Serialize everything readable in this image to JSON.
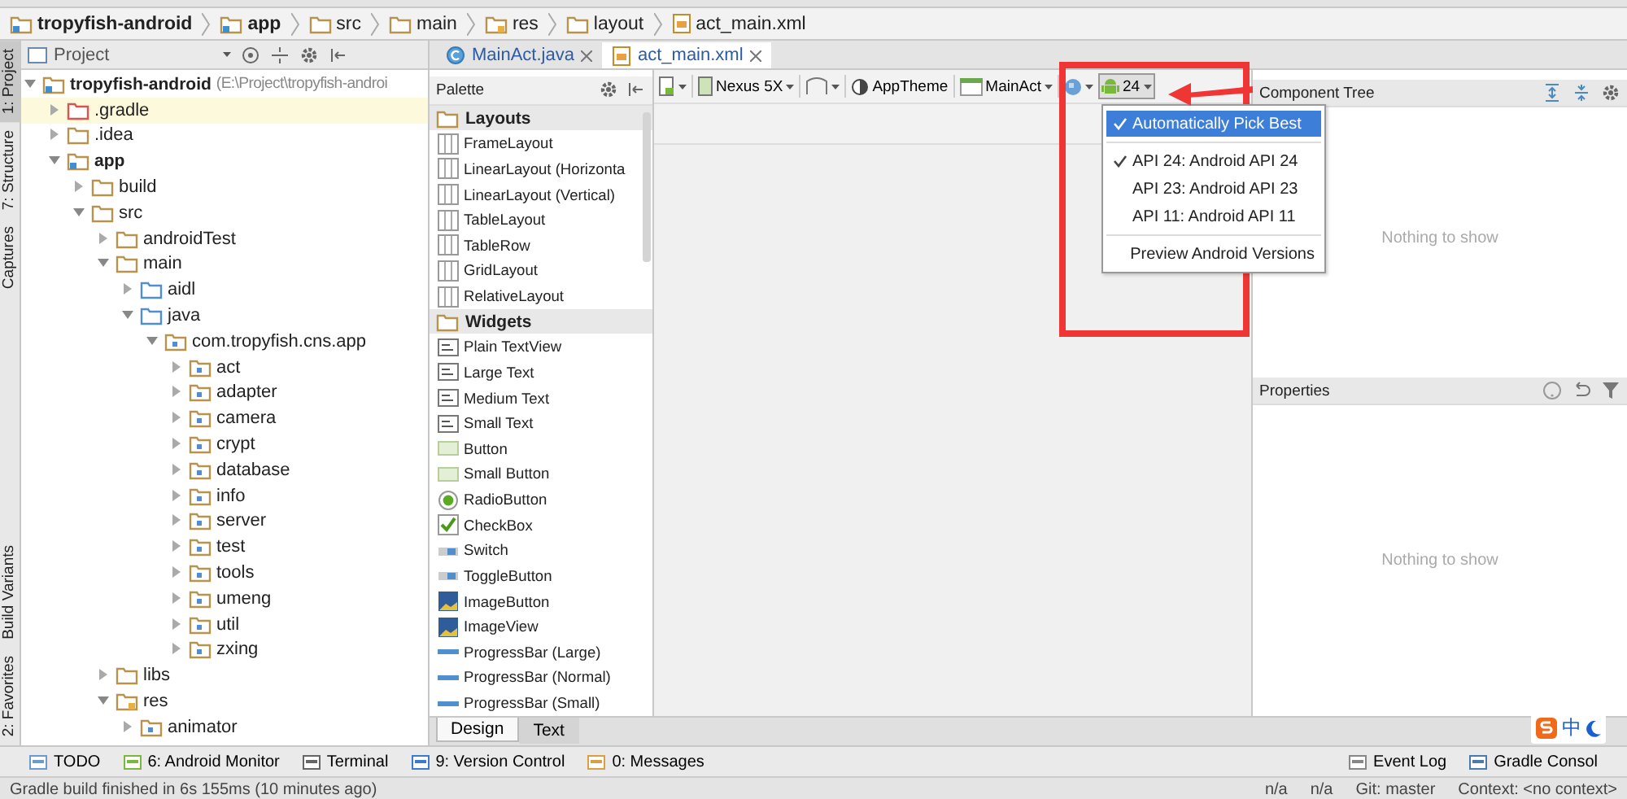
{
  "breadcrumbs": [
    {
      "label": "tropyfish-android",
      "kind": "module"
    },
    {
      "label": "app",
      "kind": "module"
    },
    {
      "label": "src",
      "kind": "folder"
    },
    {
      "label": "main",
      "kind": "folder"
    },
    {
      "label": "res",
      "kind": "resources"
    },
    {
      "label": "layout",
      "kind": "folder"
    },
    {
      "label": "act_main.xml",
      "kind": "xml"
    }
  ],
  "side_tabs_top": [
    {
      "label": "1: Project",
      "selected": true
    },
    {
      "label": "7: Structure",
      "selected": false
    },
    {
      "label": "Captures",
      "selected": false
    }
  ],
  "side_tabs_bottom": [
    {
      "label": "Build Variants",
      "selected": false
    },
    {
      "label": "2: Favorites",
      "selected": false
    }
  ],
  "project": {
    "view": "Project",
    "tree": [
      {
        "label": "tropyfish-android",
        "path": "(E:\\Project\\tropyfish-androi",
        "kind": "module",
        "expanded": true,
        "selected": false,
        "children": [
          {
            "label": ".gradle",
            "kind": "excluded",
            "expanded": false,
            "selected": true
          },
          {
            "label": ".idea",
            "kind": "folder",
            "expanded": false,
            "selected": false
          },
          {
            "label": "app",
            "kind": "module",
            "expanded": true,
            "selected": false,
            "children": [
              {
                "label": "build",
                "kind": "folder",
                "expanded": false,
                "selected": false
              },
              {
                "label": "src",
                "kind": "folder",
                "expanded": true,
                "selected": false,
                "children": [
                  {
                    "label": "androidTest",
                    "kind": "folder",
                    "expanded": false,
                    "selected": false
                  },
                  {
                    "label": "main",
                    "kind": "folder",
                    "expanded": true,
                    "selected": false,
                    "children": [
                      {
                        "label": "aidl",
                        "kind": "source",
                        "expanded": false,
                        "selected": false
                      },
                      {
                        "label": "java",
                        "kind": "source",
                        "expanded": true,
                        "selected": false,
                        "children": [
                          {
                            "label": "com.tropyfish.cns.app",
                            "kind": "package",
                            "expanded": true,
                            "selected": false,
                            "children": [
                              {
                                "label": "act",
                                "kind": "package",
                                "expanded": false,
                                "selected": false
                              },
                              {
                                "label": "adapter",
                                "kind": "package",
                                "expanded": false,
                                "selected": false
                              },
                              {
                                "label": "camera",
                                "kind": "package",
                                "expanded": false,
                                "selected": false
                              },
                              {
                                "label": "crypt",
                                "kind": "package",
                                "expanded": false,
                                "selected": false
                              },
                              {
                                "label": "database",
                                "kind": "package",
                                "expanded": false,
                                "selected": false
                              },
                              {
                                "label": "info",
                                "kind": "package",
                                "expanded": false,
                                "selected": false
                              },
                              {
                                "label": "server",
                                "kind": "package",
                                "expanded": false,
                                "selected": false
                              },
                              {
                                "label": "test",
                                "kind": "package",
                                "expanded": false,
                                "selected": false
                              },
                              {
                                "label": "tools",
                                "kind": "package",
                                "expanded": false,
                                "selected": false
                              },
                              {
                                "label": "umeng",
                                "kind": "package",
                                "expanded": false,
                                "selected": false
                              },
                              {
                                "label": "util",
                                "kind": "package",
                                "expanded": false,
                                "selected": false
                              },
                              {
                                "label": "zxing",
                                "kind": "package",
                                "expanded": false,
                                "selected": false
                              }
                            ]
                          }
                        ]
                      }
                    ]
                  },
                  {
                    "label": "libs",
                    "kind": "folder",
                    "expanded": false,
                    "selected": false
                  },
                  {
                    "label": "res",
                    "kind": "resources",
                    "expanded": true,
                    "selected": false,
                    "children": [
                      {
                        "label": "animator",
                        "kind": "package",
                        "expanded": false,
                        "selected": false
                      }
                    ]
                  }
                ]
              }
            ]
          }
        ]
      }
    ]
  },
  "editor_tabs": [
    {
      "label": "MainAct.java",
      "kind": "java",
      "selected": false
    },
    {
      "label": "act_main.xml",
      "kind": "xml",
      "selected": true
    }
  ],
  "palette": {
    "title": "Palette",
    "groups": [
      {
        "label": "Layouts",
        "items": [
          {
            "label": "FrameLayout",
            "kind": "layout"
          },
          {
            "label": "LinearLayout (Horizonta",
            "kind": "layout"
          },
          {
            "label": "LinearLayout (Vertical)",
            "kind": "layout"
          },
          {
            "label": "TableLayout",
            "kind": "layout"
          },
          {
            "label": "TableRow",
            "kind": "layout"
          },
          {
            "label": "GridLayout",
            "kind": "layout"
          },
          {
            "label": "RelativeLayout",
            "kind": "layout"
          }
        ]
      },
      {
        "label": "Widgets",
        "items": [
          {
            "label": "Plain TextView",
            "kind": "text"
          },
          {
            "label": "Large Text",
            "kind": "text"
          },
          {
            "label": "Medium Text",
            "kind": "text"
          },
          {
            "label": "Small Text",
            "kind": "text"
          },
          {
            "label": "Button",
            "kind": "button"
          },
          {
            "label": "Small Button",
            "kind": "button"
          },
          {
            "label": "RadioButton",
            "kind": "radio"
          },
          {
            "label": "CheckBox",
            "kind": "checkbox"
          },
          {
            "label": "Switch",
            "kind": "switch"
          },
          {
            "label": "ToggleButton",
            "kind": "switch"
          },
          {
            "label": "ImageButton",
            "kind": "image"
          },
          {
            "label": "ImageView",
            "kind": "image"
          },
          {
            "label": "ProgressBar (Large)",
            "kind": "progress"
          },
          {
            "label": "ProgressBar (Normal)",
            "kind": "progress"
          },
          {
            "label": "ProgressBar (Small)",
            "kind": "progress"
          }
        ]
      }
    ]
  },
  "design_toolbar": {
    "device": "Nexus 5X",
    "theme": "AppTheme",
    "activity": "MainAct",
    "api": "24"
  },
  "api_menu": {
    "items": [
      {
        "kind": "item",
        "label": "Automatically Pick Best",
        "checked": true,
        "selected": true
      },
      {
        "kind": "separator"
      },
      {
        "kind": "item",
        "label": "API 24: Android API 24",
        "checked": true,
        "selected": false
      },
      {
        "kind": "item",
        "label": "API 23: Android API 23",
        "checked": false,
        "selected": false
      },
      {
        "kind": "item",
        "label": "API 11: Android API 11",
        "checked": false,
        "selected": false
      },
      {
        "kind": "separator"
      },
      {
        "kind": "item",
        "label": "Preview Android Versions",
        "checked": false,
        "selected": false
      }
    ]
  },
  "component_tree": {
    "title": "Component Tree",
    "empty_text": "Nothing to show"
  },
  "properties": {
    "title": "Properties",
    "empty_text": "Nothing to show"
  },
  "mode_tabs": [
    {
      "label": "Design",
      "selected": true
    },
    {
      "label": "Text",
      "selected": false
    }
  ],
  "tool_windows_left": [
    {
      "label": "TODO",
      "kind": "todo"
    },
    {
      "label": "6: Android Monitor",
      "kind": "android"
    },
    {
      "label": "Terminal",
      "kind": "terminal"
    },
    {
      "label": "9: Version Control",
      "kind": "vcs"
    },
    {
      "label": "0: Messages",
      "kind": "messages"
    }
  ],
  "tool_windows_right": [
    {
      "label": "Event Log",
      "kind": "log"
    },
    {
      "label": "Gradle Consol",
      "kind": "console"
    }
  ],
  "status": {
    "message": "Gradle build finished in 6s 155ms (10 minutes ago)",
    "segments": [
      "n/a",
      "n/a",
      "Git: master",
      "Context: <no context>"
    ]
  },
  "ime": {
    "label": "中"
  }
}
